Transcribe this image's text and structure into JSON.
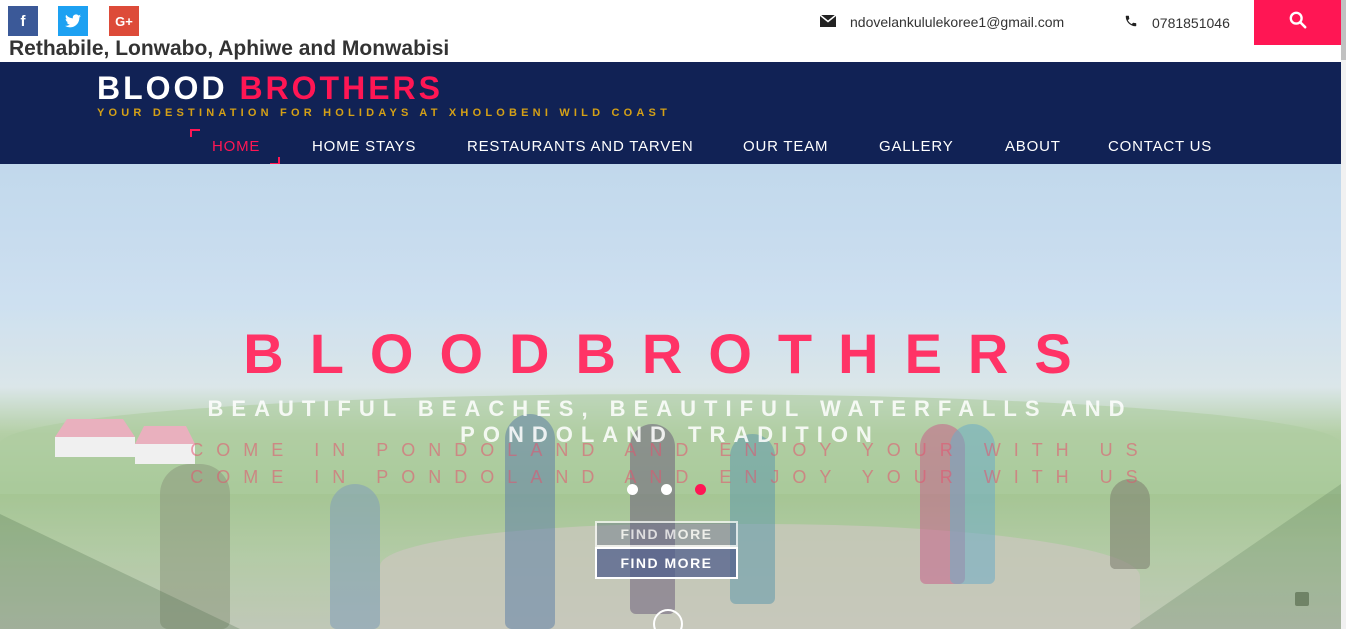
{
  "topbar": {
    "social": [
      {
        "icon": "facebook-icon",
        "glyph": "f",
        "color": "#3b5998"
      },
      {
        "icon": "twitter-icon",
        "glyph": "t",
        "color": "#1da1f2"
      },
      {
        "icon": "google-plus-icon",
        "glyph": "G+",
        "color": "#dd4b39"
      }
    ],
    "owners": "Rethabile, Lonwabo, Aphiwe and Monwabisi",
    "email": "ndovelankululekoree1@gmail.com",
    "phone": "0781851046",
    "search_color": "#ff1654"
  },
  "header": {
    "brand_first": "BLOOD",
    "brand_second": "BROTHERS",
    "tagline": "YOUR DESTINATION FOR HOLIDAYS AT XHOLOBENI WILD COAST",
    "background": "#112255",
    "accent": "#ff1654",
    "tagline_color": "#d4a017"
  },
  "nav": {
    "items": [
      {
        "label": "HOME",
        "active": true
      },
      {
        "label": "HOME STAYS",
        "active": false
      },
      {
        "label": "RESTAURANTS AND TARVEN",
        "active": false
      },
      {
        "label": "OUR TEAM",
        "active": false
      },
      {
        "label": "GALLERY",
        "active": false
      },
      {
        "label": "ABOUT",
        "active": false
      },
      {
        "label": "CONTACT US",
        "active": false
      }
    ]
  },
  "hero": {
    "title": "BLOODBROTHERS",
    "subtitle": "BEAUTIFUL BEACHES, BEAUTIFUL WATERFALLS AND PONDOLAND TRADITION",
    "line1": "COME IN PONDOLAND AND ENJOY YOUR WITH US",
    "line2": "COME IN PONDOLAND AND ENJOY YOUR WITH US",
    "button_primary": "FIND MORE",
    "button_secondary": "FIND MORE",
    "slides": 3,
    "active_slide": 3
  }
}
